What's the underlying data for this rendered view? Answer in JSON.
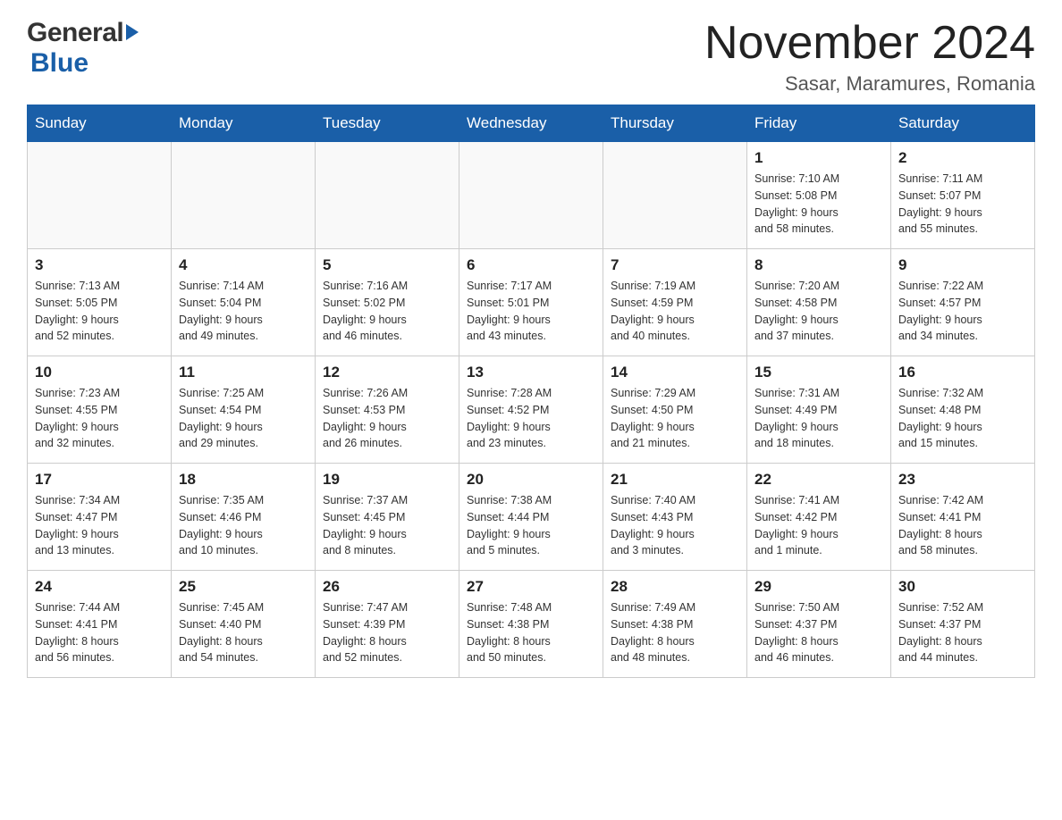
{
  "logo": {
    "general": "General",
    "blue": "Blue",
    "triangle": "▶"
  },
  "title": {
    "month": "November 2024",
    "location": "Sasar, Maramures, Romania"
  },
  "weekdays": [
    "Sunday",
    "Monday",
    "Tuesday",
    "Wednesday",
    "Thursday",
    "Friday",
    "Saturday"
  ],
  "weeks": [
    [
      {
        "day": "",
        "info": ""
      },
      {
        "day": "",
        "info": ""
      },
      {
        "day": "",
        "info": ""
      },
      {
        "day": "",
        "info": ""
      },
      {
        "day": "",
        "info": ""
      },
      {
        "day": "1",
        "info": "Sunrise: 7:10 AM\nSunset: 5:08 PM\nDaylight: 9 hours\nand 58 minutes."
      },
      {
        "day": "2",
        "info": "Sunrise: 7:11 AM\nSunset: 5:07 PM\nDaylight: 9 hours\nand 55 minutes."
      }
    ],
    [
      {
        "day": "3",
        "info": "Sunrise: 7:13 AM\nSunset: 5:05 PM\nDaylight: 9 hours\nand 52 minutes."
      },
      {
        "day": "4",
        "info": "Sunrise: 7:14 AM\nSunset: 5:04 PM\nDaylight: 9 hours\nand 49 minutes."
      },
      {
        "day": "5",
        "info": "Sunrise: 7:16 AM\nSunset: 5:02 PM\nDaylight: 9 hours\nand 46 minutes."
      },
      {
        "day": "6",
        "info": "Sunrise: 7:17 AM\nSunset: 5:01 PM\nDaylight: 9 hours\nand 43 minutes."
      },
      {
        "day": "7",
        "info": "Sunrise: 7:19 AM\nSunset: 4:59 PM\nDaylight: 9 hours\nand 40 minutes."
      },
      {
        "day": "8",
        "info": "Sunrise: 7:20 AM\nSunset: 4:58 PM\nDaylight: 9 hours\nand 37 minutes."
      },
      {
        "day": "9",
        "info": "Sunrise: 7:22 AM\nSunset: 4:57 PM\nDaylight: 9 hours\nand 34 minutes."
      }
    ],
    [
      {
        "day": "10",
        "info": "Sunrise: 7:23 AM\nSunset: 4:55 PM\nDaylight: 9 hours\nand 32 minutes."
      },
      {
        "day": "11",
        "info": "Sunrise: 7:25 AM\nSunset: 4:54 PM\nDaylight: 9 hours\nand 29 minutes."
      },
      {
        "day": "12",
        "info": "Sunrise: 7:26 AM\nSunset: 4:53 PM\nDaylight: 9 hours\nand 26 minutes."
      },
      {
        "day": "13",
        "info": "Sunrise: 7:28 AM\nSunset: 4:52 PM\nDaylight: 9 hours\nand 23 minutes."
      },
      {
        "day": "14",
        "info": "Sunrise: 7:29 AM\nSunset: 4:50 PM\nDaylight: 9 hours\nand 21 minutes."
      },
      {
        "day": "15",
        "info": "Sunrise: 7:31 AM\nSunset: 4:49 PM\nDaylight: 9 hours\nand 18 minutes."
      },
      {
        "day": "16",
        "info": "Sunrise: 7:32 AM\nSunset: 4:48 PM\nDaylight: 9 hours\nand 15 minutes."
      }
    ],
    [
      {
        "day": "17",
        "info": "Sunrise: 7:34 AM\nSunset: 4:47 PM\nDaylight: 9 hours\nand 13 minutes."
      },
      {
        "day": "18",
        "info": "Sunrise: 7:35 AM\nSunset: 4:46 PM\nDaylight: 9 hours\nand 10 minutes."
      },
      {
        "day": "19",
        "info": "Sunrise: 7:37 AM\nSunset: 4:45 PM\nDaylight: 9 hours\nand 8 minutes."
      },
      {
        "day": "20",
        "info": "Sunrise: 7:38 AM\nSunset: 4:44 PM\nDaylight: 9 hours\nand 5 minutes."
      },
      {
        "day": "21",
        "info": "Sunrise: 7:40 AM\nSunset: 4:43 PM\nDaylight: 9 hours\nand 3 minutes."
      },
      {
        "day": "22",
        "info": "Sunrise: 7:41 AM\nSunset: 4:42 PM\nDaylight: 9 hours\nand 1 minute."
      },
      {
        "day": "23",
        "info": "Sunrise: 7:42 AM\nSunset: 4:41 PM\nDaylight: 8 hours\nand 58 minutes."
      }
    ],
    [
      {
        "day": "24",
        "info": "Sunrise: 7:44 AM\nSunset: 4:41 PM\nDaylight: 8 hours\nand 56 minutes."
      },
      {
        "day": "25",
        "info": "Sunrise: 7:45 AM\nSunset: 4:40 PM\nDaylight: 8 hours\nand 54 minutes."
      },
      {
        "day": "26",
        "info": "Sunrise: 7:47 AM\nSunset: 4:39 PM\nDaylight: 8 hours\nand 52 minutes."
      },
      {
        "day": "27",
        "info": "Sunrise: 7:48 AM\nSunset: 4:38 PM\nDaylight: 8 hours\nand 50 minutes."
      },
      {
        "day": "28",
        "info": "Sunrise: 7:49 AM\nSunset: 4:38 PM\nDaylight: 8 hours\nand 48 minutes."
      },
      {
        "day": "29",
        "info": "Sunrise: 7:50 AM\nSunset: 4:37 PM\nDaylight: 8 hours\nand 46 minutes."
      },
      {
        "day": "30",
        "info": "Sunrise: 7:52 AM\nSunset: 4:37 PM\nDaylight: 8 hours\nand 44 minutes."
      }
    ]
  ]
}
